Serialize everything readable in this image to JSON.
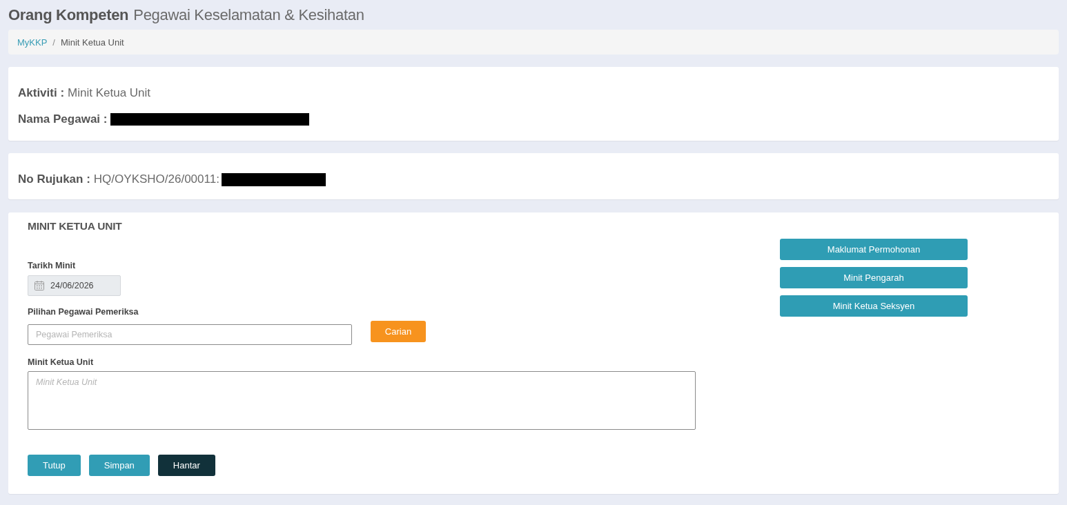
{
  "header": {
    "title": "Orang Kompeten",
    "subtitle": "Pegawai Keselamatan & Kesihatan"
  },
  "breadcrumb": {
    "separator": "/",
    "items": [
      {
        "label": "MyKKP",
        "kind": "link"
      },
      {
        "label": "Minit Ketua Unit",
        "kind": "current"
      }
    ]
  },
  "info_card": {
    "fields": [
      {
        "label": "Aktiviti :",
        "value": "Minit Ketua Unit",
        "redacted": false
      },
      {
        "label": "Nama Pegawai :",
        "redacted": true
      }
    ]
  },
  "reference_card": {
    "fields": [
      {
        "label": "No Rujukan :",
        "value": "HQ/OYKSHO/26/00011:",
        "redacted": true
      }
    ]
  },
  "form": {
    "title": "MINIT KETUA UNIT",
    "date": {
      "label": "Tarikh Minit",
      "value": "24/06/2026",
      "disabled": true
    },
    "officer": {
      "label": "Pilihan Pegawai Pemeriksa",
      "placeholder": "Pegawai Pemeriksa",
      "button": "Carian"
    },
    "minute": {
      "label": "Minit Ketua Unit",
      "placeholder": "Minit Ketua Unit"
    },
    "actions": [
      {
        "label": "Tutup",
        "kind": "primary"
      },
      {
        "label": "Simpan",
        "kind": "primary"
      },
      {
        "label": "Hantar",
        "kind": "dark"
      }
    ],
    "side_buttons": [
      "Maklumat Permohonan",
      "Minit Pengarah",
      "Minit Ketua Seksyen"
    ]
  }
}
